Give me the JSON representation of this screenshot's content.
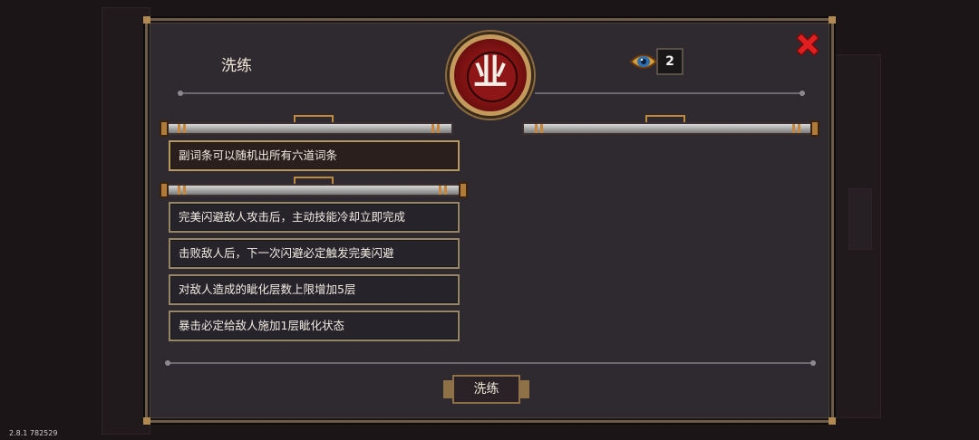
{
  "panel": {
    "title": "洗练",
    "emblem_glyph": "业",
    "currency": {
      "icon": "eye-gem-icon",
      "count": "2"
    },
    "close_icon": "close-x-icon"
  },
  "primary_stat": "副词条可以随机出所有六道词条",
  "secondary_stats": [
    "完美闪避敌人攻击后，主动技能冷却立即完成",
    "击败敌人后，下一次闪避必定触发完美闪避",
    "对敌人造成的眦化层数上限增加5层",
    "暴击必定给敌人施加1层眦化状态"
  ],
  "refine_button": {
    "label": "洗练"
  },
  "version_text": "2.8.1 782529",
  "colors": {
    "panel_bg": "#2f2a30",
    "gold_border": "#958765",
    "emblem_red": "#a41e1e",
    "close_red": "#e02020"
  }
}
